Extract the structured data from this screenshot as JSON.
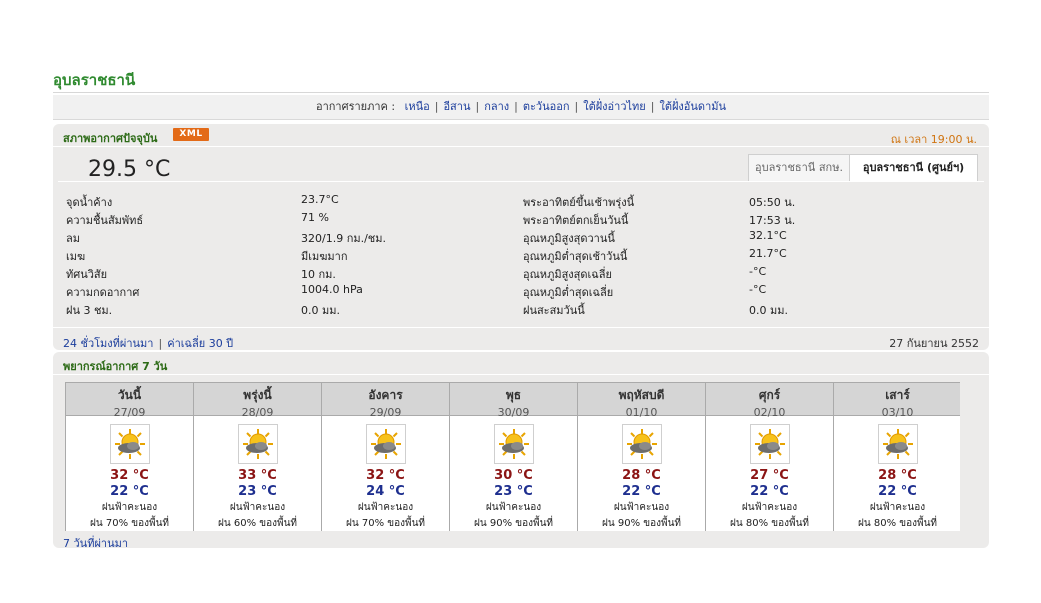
{
  "city": "อุบลราชธานี",
  "region_bar": {
    "label": "อากาศรายภาค :",
    "links": [
      "เหนือ",
      "อีสาน",
      "กลาง",
      "ตะวันออก",
      "ใต้ฝั่งอ่าวไทย",
      "ใต้ฝั่งอันดามัน"
    ]
  },
  "current": {
    "title": "สภาพอากาศปัจจุบัน",
    "xml_badge": "XML",
    "time": "ณ เวลา 19:00 น.",
    "temperature": "29.5 °C",
    "tabs": [
      "อุบลราชธานี สกษ.",
      "อุบลราชธานี (ศูนย์ฯ)"
    ],
    "left_rows": [
      {
        "label": "จุดน้ำค้าง",
        "value": "23.7°C"
      },
      {
        "label": "ความชื้นสัมพัทธ์",
        "value": "71 %"
      },
      {
        "label": "ลม",
        "value": "320/1.9 กม./ชม."
      },
      {
        "label": "เมฆ",
        "value": "มีเมฆมาก"
      },
      {
        "label": "ทัศนวิสัย",
        "value": "10 กม."
      },
      {
        "label": "ความกดอากาศ",
        "value": "1004.0 hPa"
      },
      {
        "label": "ฝน 3 ชม.",
        "value": "0.0 มม."
      }
    ],
    "right_rows": [
      {
        "label": "พระอาทิตย์ขึ้นเช้าพรุ่งนี้",
        "value": "05:50 น."
      },
      {
        "label": "พระอาทิตย์ตกเย็นวันนี้",
        "value": "17:53 น."
      },
      {
        "label": "อุณหภูมิสูงสุดวานนี้",
        "value": "32.1°C"
      },
      {
        "label": "อุณหภูมิต่ำสุดเช้าวันนี้",
        "value": "21.7°C"
      },
      {
        "label": "อุณหภูมิสูงสุดเฉลี่ย",
        "value": "-°C"
      },
      {
        "label": "อุณหภูมิต่ำสุดเฉลี่ย",
        "value": "-°C"
      },
      {
        "label": "ฝนสะสมวันนี้",
        "value": "0.0 มม."
      }
    ],
    "footer_links": [
      "24 ชั่วโมงที่ผ่านมา",
      "ค่าเฉลี่ย 30 ปี"
    ],
    "footer_date": "27 กันยายน 2552"
  },
  "forecast": {
    "title": "พยากรณ์อากาศ 7 วัน",
    "days": [
      {
        "name": "วันนี้",
        "date": "27/09",
        "high": "32 °C",
        "low": "22 °C",
        "condition": "ฝนฟ้าคะนอง",
        "rain": "ฝน 70% ของพื้นที่"
      },
      {
        "name": "พรุ่งนี้",
        "date": "28/09",
        "high": "33 °C",
        "low": "23 °C",
        "condition": "ฝนฟ้าคะนอง",
        "rain": "ฝน 60% ของพื้นที่"
      },
      {
        "name": "อังคาร",
        "date": "29/09",
        "high": "32 °C",
        "low": "24 °C",
        "condition": "ฝนฟ้าคะนอง",
        "rain": "ฝน 70% ของพื้นที่"
      },
      {
        "name": "พุธ",
        "date": "30/09",
        "high": "30 °C",
        "low": "23 °C",
        "condition": "ฝนฟ้าคะนอง",
        "rain": "ฝน 90% ของพื้นที่"
      },
      {
        "name": "พฤหัสบดี",
        "date": "01/10",
        "high": "28 °C",
        "low": "22 °C",
        "condition": "ฝนฟ้าคะนอง",
        "rain": "ฝน 90% ของพื้นที่"
      },
      {
        "name": "ศุกร์",
        "date": "02/10",
        "high": "27 °C",
        "low": "22 °C",
        "condition": "ฝนฟ้าคะนอง",
        "rain": "ฝน 80% ของพื้นที่"
      },
      {
        "name": "เสาร์",
        "date": "03/10",
        "high": "28 °C",
        "low": "22 °C",
        "condition": "ฝนฟ้าคะนอง",
        "rain": "ฝน 80% ของพื้นที่"
      }
    ],
    "footer_link": "7 วันที่ผ่านมา",
    "icon": "sun-cloud-storm-icon"
  },
  "colors": {
    "title_green": "#2f8a2f",
    "link_blue": "#1b3d9c",
    "xml_orange": "#e36a17",
    "high_red": "#8b1414",
    "low_blue": "#1e2f8f"
  }
}
